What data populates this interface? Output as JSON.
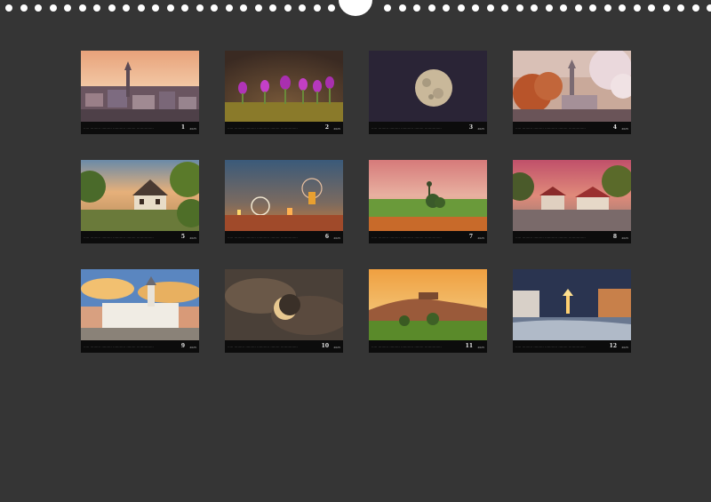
{
  "tiles": [
    {
      "month": "1",
      "year": "2025",
      "caption": "..... .........  ......... ........... ........  ..............."
    },
    {
      "month": "2",
      "year": "2025",
      "caption": "..... .........  ......... ........... ........  ..............."
    },
    {
      "month": "3",
      "year": "2025",
      "caption": "..... .........  ......... ........... ........  ..............."
    },
    {
      "month": "4",
      "year": "2025",
      "caption": "..... .........  ......... ........... ........  ..............."
    },
    {
      "month": "5",
      "year": "2025",
      "caption": "..... .........  ......... ........... ........  ..............."
    },
    {
      "month": "6",
      "year": "2025",
      "caption": "..... .........  ......... ........... ........  ..............."
    },
    {
      "month": "7",
      "year": "2025",
      "caption": "..... .........  ......... ........... ........  ..............."
    },
    {
      "month": "8",
      "year": "2025",
      "caption": "..... .........  ......... ........... ........  ..............."
    },
    {
      "month": "9",
      "year": "2025",
      "caption": "..... .........  ......... ........... ........  ..............."
    },
    {
      "month": "10",
      "year": "2025",
      "caption": "..... .........  ......... ........... ........  ..............."
    },
    {
      "month": "11",
      "year": "2025",
      "caption": "..... .........  ......... ........... ........  ..............."
    },
    {
      "month": "12",
      "year": "2025",
      "caption": "..... .........  ......... ........... ........  ..............."
    }
  ],
  "colors": {
    "page_background": "#353535",
    "binding_holes": "#ffffff",
    "caption_bar": "#0c0c0c"
  }
}
